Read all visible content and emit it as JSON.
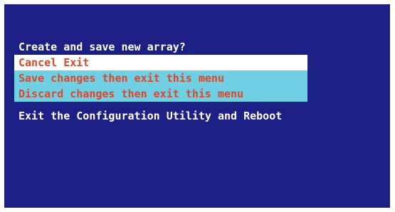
{
  "dialog": {
    "prompt": "Create and save new array?",
    "options": [
      {
        "label": "Cancel Exit",
        "selected": true
      },
      {
        "label": "Save changes then exit this menu",
        "selected": false
      },
      {
        "label": "Discard changes then exit this menu",
        "selected": false
      }
    ]
  },
  "footer": {
    "text": "Exit the Configuration Utility and Reboot"
  },
  "colors": {
    "background": "#1c1f84",
    "prompt_text": "#ffffff",
    "option_text": "#e0452a",
    "option_bg": "#6fcfe3",
    "selected_bg": "#ffffff"
  }
}
